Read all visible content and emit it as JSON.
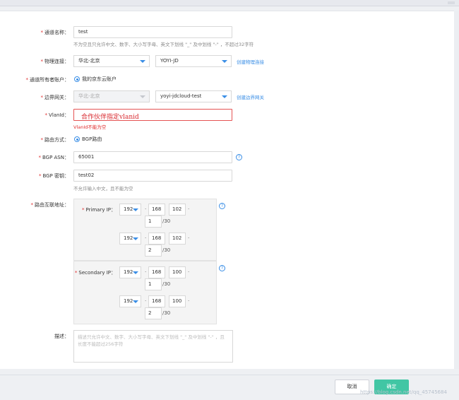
{
  "form": {
    "channel_name": {
      "label": "通道名称：",
      "value": "test",
      "hint": "不为空且只允许中文、数字、大小写字母、英文下划线 \"_\" 及中划线 \"-\" ，不超过32字符"
    },
    "physical_connection": {
      "label": "物理连接：",
      "region": "华北-北京",
      "connection": "YOYI-JD",
      "link": "创建物理连接"
    },
    "owner_account": {
      "label": "通道所有者账户：",
      "option": "我的京东云账户"
    },
    "border_gateway": {
      "label": "边界网关：",
      "region": "华北-北京",
      "gateway": "yoyi-jdcloud-test",
      "link": "创建边界网关"
    },
    "vlan_id": {
      "label": "VlanId：",
      "overlay": "合作伙伴指定vlanid",
      "error": "VlanId不能为空"
    },
    "routing_mode": {
      "label": "路由方式：",
      "option": "BGP路由"
    },
    "bgp_asn": {
      "label": "BGP ASN：",
      "value": "65001"
    },
    "bgp_key": {
      "label": "BGP 密钥：",
      "value": "test02",
      "hint": "不允许输入中文，且不能为空"
    },
    "route_interconnect": {
      "label": "路由互联地址：",
      "primary_label": "Primary IP：",
      "secondary_label": "Secondary IP：",
      "primary": [
        {
          "o1": "192",
          "o2": "168",
          "o3": "102",
          "o4": "1",
          "mask": "/30"
        },
        {
          "o1": "192",
          "o2": "168",
          "o3": "102",
          "o4": "2",
          "mask": "/30"
        }
      ],
      "secondary": [
        {
          "o1": "192",
          "o2": "168",
          "o3": "100",
          "o4": "1",
          "mask": "/30"
        },
        {
          "o1": "192",
          "o2": "168",
          "o3": "100",
          "o4": "2",
          "mask": "/30"
        }
      ]
    },
    "description": {
      "label": "描述：",
      "placeholder_line1": "描述只允许中文、数字、大小写字母、英文下划线 \"_\" 及中划线 \"-\" ，且",
      "placeholder_line2": "长度不能超过256字符"
    }
  },
  "help_symbol": "?",
  "dot_symbol": "·",
  "required_symbol": "*",
  "footer": {
    "cancel": "取消",
    "ok": "确定",
    "watermark": "https://blog.csdn.net/qq_45745684"
  },
  "colors": {
    "accent": "#3a8ee6",
    "error": "#e02d2d",
    "confirm": "#41c6a4"
  }
}
